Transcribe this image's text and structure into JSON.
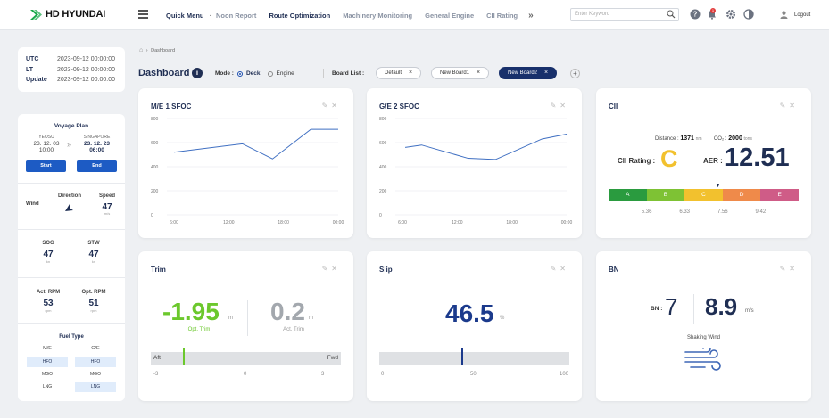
{
  "header": {
    "logo": "HD HYUNDAI",
    "nav": [
      "Quick Menu",
      "Noon Report",
      "Route Optimization",
      "Machinery Monitoring",
      "General Engine",
      "CII Rating"
    ],
    "active_nav": "Route Optimization",
    "more": "»",
    "search_placeholder": "Enter Keyword",
    "notification_count": "1",
    "logout": "Logout"
  },
  "sidebar": {
    "time": [
      {
        "label": "UTC",
        "value": "2023-09-12 00:00:00"
      },
      {
        "label": "LT",
        "value": "2023-09-12 00:00:00"
      },
      {
        "label": "Update",
        "value": "2023-09-12 00:00:00"
      }
    ],
    "voyage": {
      "title": "Voyage Plan",
      "from": {
        "port": "YEOSU",
        "date": "23. 12. 03",
        "time": "10:00"
      },
      "to": {
        "port": "SINGAPORE",
        "date": "23. 12. 23",
        "time": "06:00"
      },
      "arrow": "»",
      "start": "Start",
      "end": "End"
    },
    "wind": {
      "label": "Wind",
      "direction_label": "Direction",
      "speed_label": "Speed",
      "speed": "47",
      "speed_unit": "m/s"
    },
    "speed": {
      "sog_label": "SOG",
      "sog": "47",
      "sog_unit": "kn",
      "stw_label": "STW",
      "stw": "47",
      "stw_unit": "kn"
    },
    "rpm": {
      "act_label": "Act. RPM",
      "act": "53",
      "act_unit": "rpm",
      "opt_label": "Opt. RPM",
      "opt": "51",
      "opt_unit": "rpm"
    },
    "fuel": {
      "title": "Fuel Type",
      "cols": [
        "M/E",
        "G/E"
      ],
      "rows": [
        [
          "HFO",
          "HFO"
        ],
        [
          "MGO",
          "MGO"
        ],
        [
          "LNG",
          "LNG"
        ]
      ],
      "selected": [
        [
          true,
          true
        ],
        [
          false,
          false
        ],
        [
          false,
          true
        ]
      ]
    }
  },
  "breadcrumb": {
    "home": "⌂",
    "sep": "›",
    "page": "Dashboard"
  },
  "toolbar": {
    "title": "Dashboard",
    "info": "i",
    "mode_label": "Mode :",
    "modes": [
      "Deck",
      "Engine"
    ],
    "board_list_label": "Board List :",
    "boards": [
      "Default",
      "New Board1",
      "New Board2"
    ],
    "active_board": "New Board2",
    "plus": "+"
  },
  "cards": {
    "me_sfoc": {
      "title": "M/E 1 SFOC"
    },
    "ge_sfoc": {
      "title": "G/E 2 SFOC"
    },
    "cii": {
      "title": "CII",
      "distance_label": "Distance :",
      "distance": "1371",
      "distance_unit": "nm",
      "co2_label": "CO₂ :",
      "co2": "2000",
      "co2_unit": "tons",
      "rating_label": "CII Rating :",
      "rating": "C",
      "aer_label": "AER :",
      "aer": "12.51",
      "grades": [
        "A",
        "B",
        "C",
        "D",
        "E"
      ],
      "grade_colors": [
        "#2a9b3f",
        "#7ec234",
        "#f2c12e",
        "#ef8a4a",
        "#cf5c87"
      ],
      "thresholds": [
        "5.36",
        "6.33",
        "7.56",
        "9.42"
      ],
      "marker_fraction": 0.575
    },
    "trim": {
      "title": "Trim",
      "opt_value": "-1.95",
      "opt_unit": "m",
      "opt_label": "Opt. Trim",
      "act_value": "0.2",
      "act_unit": "m",
      "act_label": "Act. Trim",
      "aft": "Aft",
      "fwd": "Fwd",
      "ticks": [
        "-3",
        "0",
        "3"
      ],
      "opt_marker": -1.95,
      "act_marker": 0.2,
      "range": [
        -3,
        3
      ]
    },
    "slip": {
      "title": "Slip",
      "value": "46.5",
      "unit": "%",
      "ticks": [
        "0",
        "50",
        "100"
      ],
      "marker": 43
    },
    "bn": {
      "title": "BN",
      "bn_label": "BN :",
      "bn": "7",
      "wind": "8.9",
      "wind_unit": "m/s",
      "description": "Shaking Wind"
    }
  },
  "chart_data": [
    {
      "type": "line",
      "title": "M/E 1 SFOC",
      "x": [
        "6:00",
        "12:00",
        "18:00",
        "00:00"
      ],
      "series": [
        {
          "values": [
            520,
            590,
            465,
            710,
            710
          ]
        }
      ],
      "x_points": [
        0,
        1.25,
        1.8,
        2.5,
        3.0
      ],
      "y_ticks": [
        0,
        200,
        400,
        600,
        800
      ],
      "ylim": [
        0,
        800
      ]
    },
    {
      "type": "line",
      "title": "G/E 2 SFOC",
      "x": [
        "6:00",
        "12:00",
        "18:00",
        "00:00"
      ],
      "series": [
        {
          "values": [
            560,
            580,
            470,
            460,
            630,
            670
          ]
        }
      ],
      "x_points": [
        0.05,
        0.35,
        1.2,
        1.7,
        2.55,
        3.0
      ],
      "y_ticks": [
        0,
        200,
        400,
        600,
        800
      ],
      "ylim": [
        0,
        800
      ]
    }
  ]
}
